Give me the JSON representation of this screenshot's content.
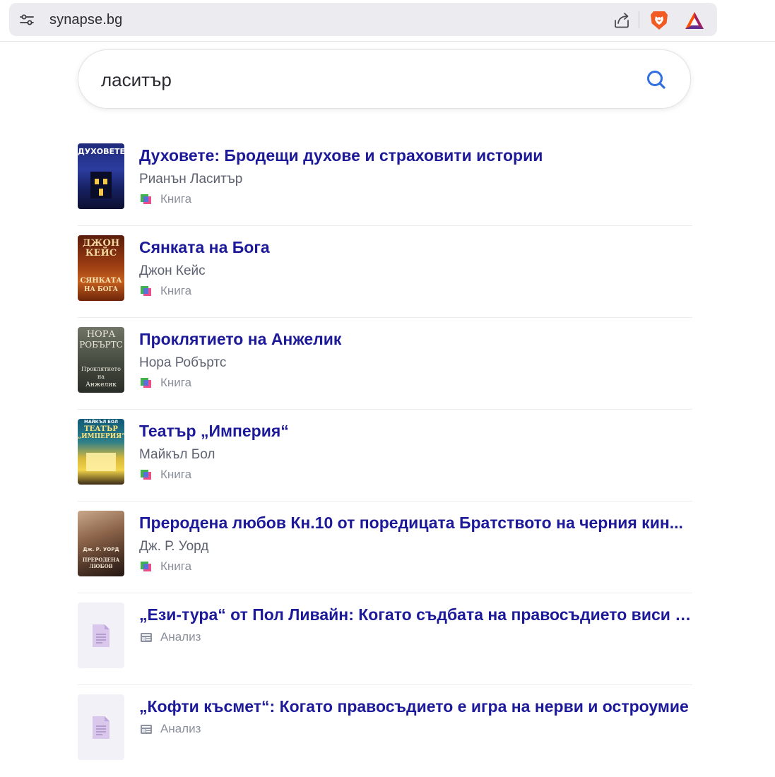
{
  "browser": {
    "url": "synapse.bg",
    "icons": [
      "tune-icon",
      "share-icon",
      "brave-lion-icon",
      "bat-triangle-icon"
    ]
  },
  "search": {
    "query": "ласитър",
    "button_icon": "search-icon",
    "accent": "#2f6fe0"
  },
  "colors": {
    "title": "#1d1a9a",
    "meta": "#5e6270",
    "type": "#8a8e9b"
  },
  "results": [
    {
      "title": "Духовете: Бродещи духове и страховити истории",
      "author": "Рианън Ласитър",
      "type": "Книга",
      "type_icon": "book-icon",
      "cover_text": [
        "ДУХОВЕТЕ"
      ]
    },
    {
      "title": "Сянката на Бога",
      "author": "Джон Кейс",
      "type": "Книга",
      "type_icon": "book-icon",
      "cover_text": [
        "ДЖОН",
        "КЕЙС",
        "СЯНКАТА",
        "НА БОГА"
      ]
    },
    {
      "title": "Проклятието на Анжелик",
      "author": "Нора Робъртс",
      "type": "Книга",
      "type_icon": "book-icon",
      "cover_text": [
        "НОРА",
        "РОБЪРТС",
        "Проклятието",
        "на",
        "Анжелик"
      ]
    },
    {
      "title": "Театър „Империя“",
      "author": "Майкъл Бол",
      "type": "Книга",
      "type_icon": "book-icon",
      "cover_text": [
        "МАЙКЪЛ БОЛ",
        "ТЕАТЪР",
        "„ИМПЕРИЯ“"
      ]
    },
    {
      "title": "Преродена любов Кн.10 от поредицата Братството на черния кин...",
      "author": "Дж. Р. Уорд",
      "type": "Книга",
      "type_icon": "book-icon",
      "cover_text": [
        "Дж. Р. УОРД",
        "ПРЕРОДЕНА",
        "ЛЮБОВ"
      ]
    },
    {
      "title": "„Ези-тура“ от Пол Ливайн: Когато съдбата на правосъдието виси н...",
      "author": "",
      "type": "Анализ",
      "type_icon": "article-icon",
      "cover_text": []
    },
    {
      "title": "„Кофти късмет“: Когато правосъдието е игра на нерви и остроумие",
      "author": "",
      "type": "Анализ",
      "type_icon": "article-icon",
      "cover_text": []
    }
  ]
}
